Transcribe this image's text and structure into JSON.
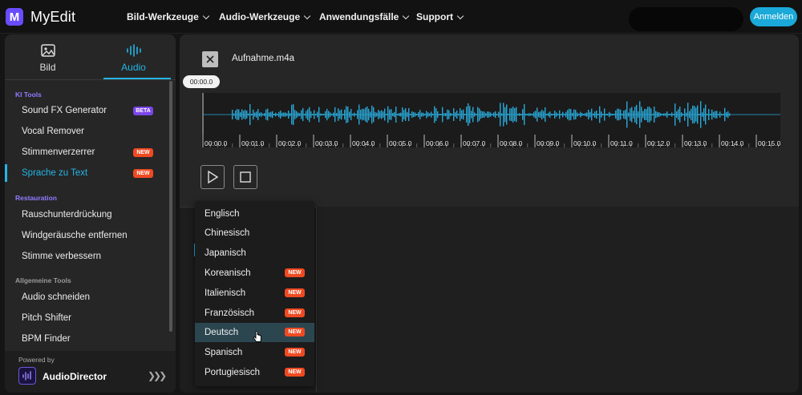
{
  "brand": {
    "name": "MyEdit",
    "logo_letter": "M",
    "accent": "#24b5e6",
    "logo_color": "#6a4cff"
  },
  "nav": {
    "items": [
      "Bild-Werkzeuge",
      "Audio-Werkzeuge",
      "Anwendungsfälle",
      "Support"
    ],
    "login_label": "Anmelden"
  },
  "sidebar": {
    "tabs": [
      {
        "label": "Bild",
        "icon": "image-icon"
      },
      {
        "label": "Audio",
        "icon": "audio-wave-icon",
        "active": true
      }
    ],
    "sections": [
      {
        "title": "KI Tools",
        "items": [
          {
            "label": "Sound FX Generator",
            "badge": "BETA"
          },
          {
            "label": "Vocal Remover"
          },
          {
            "label": "Stimmenverzerrer",
            "badge": "NEW"
          },
          {
            "label": "Sprache zu Text",
            "badge": "NEW",
            "active": true
          }
        ]
      },
      {
        "title": "Restauration",
        "items": [
          {
            "label": "Rauschunterdrückung"
          },
          {
            "label": "Windgeräusche entfernen"
          },
          {
            "label": "Stimme verbessern"
          }
        ]
      },
      {
        "title": "Allgemeine Tools",
        "items": [
          {
            "label": "Audio schneiden"
          },
          {
            "label": "Pitch Shifter"
          },
          {
            "label": "BPM Finder"
          }
        ]
      }
    ],
    "powered_by": {
      "label": "Powered by",
      "name": "AudioDirector"
    }
  },
  "editor": {
    "filename": "Aufnahme.m4a",
    "playhead_time": "00:00.0",
    "ticks": [
      "00:00.0",
      "00:01.0",
      "00:02.0",
      "00:03.0",
      "00:04.0",
      "00:05.0",
      "00:06.0",
      "00:07.0",
      "00:08.0",
      "00:09.0",
      "00:10.0",
      "00:11.0",
      "00:12.0",
      "00:13.0",
      "00:14.0",
      "00:15.0"
    ],
    "waveform_color": "#29a8d8"
  },
  "language_dropdown": {
    "items": [
      {
        "label": "Englisch"
      },
      {
        "label": "Chinesisch"
      },
      {
        "label": "Japanisch"
      },
      {
        "label": "Koreanisch",
        "badge": "NEW"
      },
      {
        "label": "Italienisch",
        "badge": "NEW"
      },
      {
        "label": "Französisch",
        "badge": "NEW"
      },
      {
        "label": "Deutsch",
        "badge": "NEW",
        "hovered": true
      },
      {
        "label": "Spanisch",
        "badge": "NEW"
      },
      {
        "label": "Portugiesisch",
        "badge": "NEW"
      }
    ]
  }
}
